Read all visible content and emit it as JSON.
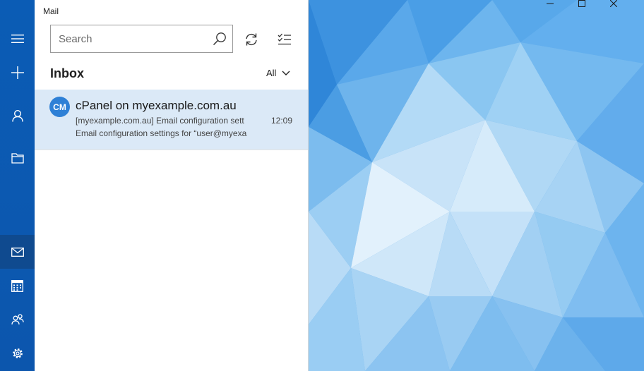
{
  "app": {
    "title": "Mail"
  },
  "rail": {
    "items": [
      {
        "icon": "hamburger-menu-icon"
      },
      {
        "icon": "new-mail-plus-icon"
      },
      {
        "icon": "accounts-person-icon"
      },
      {
        "icon": "folders-icon"
      },
      {
        "icon": "mail-envelope-icon",
        "active": true
      },
      {
        "icon": "calendar-icon"
      },
      {
        "icon": "people-icon"
      },
      {
        "icon": "settings-gear-icon"
      }
    ]
  },
  "search": {
    "placeholder": "Search",
    "value": ""
  },
  "toolbar": {
    "sync_icon": "sync-icon",
    "select_icon": "selection-mode-icon"
  },
  "folder": {
    "title": "Inbox",
    "filter_label": "All"
  },
  "messages": [
    {
      "initials": "CM",
      "sender": "cPanel on myexample.com.au",
      "subject": "[myexample.com.au] Email configuration sett",
      "preview": "Email configuration settings for “user@myexa",
      "time": "12:09"
    }
  ],
  "window_controls": {
    "minimize_icon": "minimize-icon",
    "maximize_icon": "maximize-icon",
    "close_icon": "close-icon"
  },
  "colors": {
    "rail": "#0b5cb5",
    "accent": "#2e80d6",
    "selected_row": "#dbe9f7",
    "wallpaper": "#58a6e8"
  }
}
